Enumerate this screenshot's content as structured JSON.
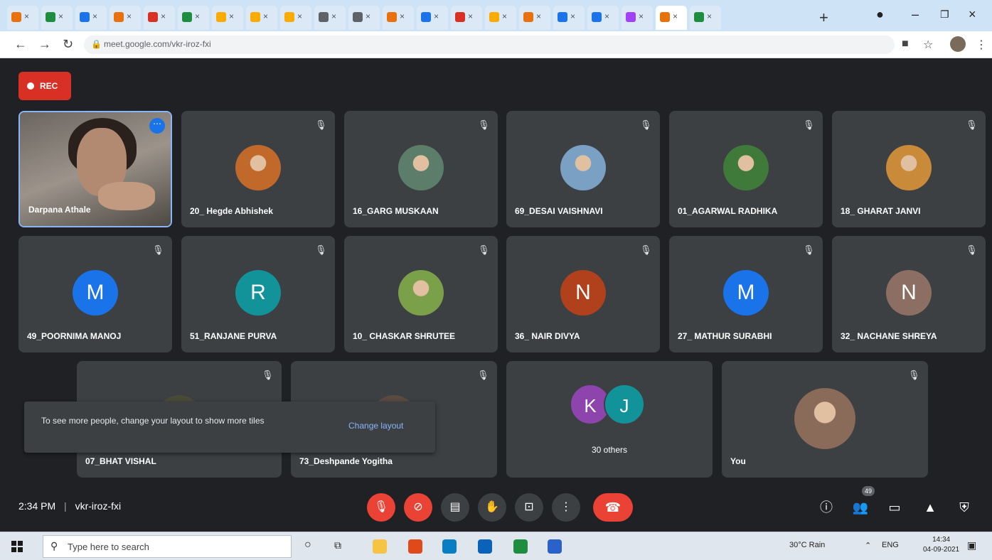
{
  "browser": {
    "url": "meet.google.com/vkr-iroz-fxi",
    "tab_favicon_colors": [
      "#e8710a",
      "#1e8e3e",
      "#1a73e8",
      "#e8710a",
      "#d93025",
      "#1e8e3e",
      "#f9ab00",
      "#f9ab00",
      "#f9ab00",
      "#5f6368",
      "#5f6368",
      "#e8710a",
      "#1a73e8",
      "#d93025",
      "#f9ab00",
      "#e8710a",
      "#1a73e8",
      "#1a73e8",
      "#a142f4",
      "#e8710a",
      "#1e8e3e"
    ]
  },
  "meet": {
    "rec_label": "REC",
    "tiles": [
      {
        "name": "Darpana Athale",
        "kind": "video"
      },
      {
        "name": "20_ Hegde Abhishek",
        "kind": "photo",
        "color": "#c0692b"
      },
      {
        "name": "16_GARG MUSKAAN",
        "kind": "photo",
        "color": "#5b7d6a"
      },
      {
        "name": "69_DESAI VAISHNAVI",
        "kind": "photo",
        "color": "#7aa0c4"
      },
      {
        "name": "01_AGARWAL RADHIKA",
        "kind": "photo",
        "color": "#3f7a3a"
      },
      {
        "name": "18_ GHARAT JANVI",
        "kind": "photo",
        "color": "#c98a3a"
      },
      {
        "name": "49_POORNIMA MANOJ",
        "kind": "letter",
        "letter": "M",
        "color": "#1a73e8"
      },
      {
        "name": "51_RANJANE PURVA",
        "kind": "letter",
        "letter": "R",
        "color": "#12939a"
      },
      {
        "name": "10_ CHASKAR SHRUTEE",
        "kind": "photo",
        "color": "#7ba04a"
      },
      {
        "name": "36_ NAIR DIVYA",
        "kind": "letter",
        "letter": "N",
        "color": "#b1401c"
      },
      {
        "name": "27_ MATHUR SURABHI",
        "kind": "letter",
        "letter": "M",
        "color": "#1a73e8"
      },
      {
        "name": "32_ NACHANE SHREYA",
        "kind": "letter",
        "letter": "N",
        "color": "#8d6e63"
      },
      {
        "name": "07_BHAT VISHAL",
        "kind": "photo",
        "color": "#4a4a38"
      },
      {
        "name": "73_Deshpande Yogitha",
        "kind": "photo",
        "color": "#5a4a40"
      },
      {
        "name": "30 others",
        "kind": "group",
        "letters": [
          "K",
          "J"
        ],
        "colors": [
          "#8e44ad",
          "#12939a"
        ]
      },
      {
        "name": "You",
        "kind": "photo",
        "color": "#8a6a58"
      }
    ],
    "snackbar": {
      "message": "To see more people, change your layout to show more tiles",
      "action": "Change layout"
    },
    "time": "2:34 PM",
    "meeting_code": "vkr-iroz-fxi",
    "separator": "|",
    "people_count": "49"
  },
  "taskbar": {
    "search_placeholder": "Type here to search",
    "weather": "30°C Rain",
    "language": "ENG",
    "time": "14:34",
    "date": "04-09-2021",
    "icon_colors": [
      "#f6c343",
      "#e04a1b",
      "#0a7ec2",
      "#0a63b8",
      "#1e8e3e",
      "#2a62c9"
    ]
  }
}
